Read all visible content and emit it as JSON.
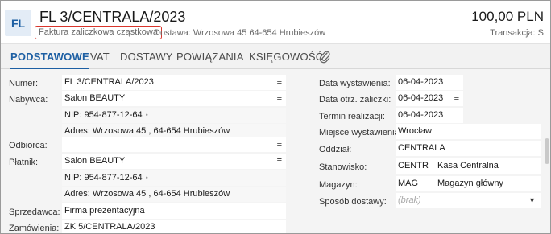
{
  "header": {
    "badge": "FL",
    "title": "FL 3/CENTRALA/2023",
    "doc_type": "Faktura zaliczkowa cząstkowa",
    "separator": "•",
    "delivery": "Dostawa: Wrzosowa  45  64-654 Hrubieszów",
    "amount": "100,00 PLN",
    "transaction": "Transakcja:  S"
  },
  "tabs": [
    "PODSTAWOWE",
    "VAT",
    "DOSTAWY",
    "POWIĄZANIA",
    "KSIĘGOWOŚĆ"
  ],
  "left": {
    "numer_label": "Numer:",
    "numer_value": "FL 3/CENTRALA/2023",
    "nabywca_label": "Nabywca:",
    "nabywca_value": "Salon BEAUTY",
    "nabywca_nip": "NIP:  954-877-12-64",
    "nabywca_adres": "Adres:  Wrzosowa  45 , 64-654 Hrubieszów",
    "odbiorca_label": "Odbiorca:",
    "odbiorca_value": "",
    "platnik_label": "Płatnik:",
    "platnik_value": "Salon BEAUTY",
    "platnik_nip": "NIP:  954-877-12-64",
    "platnik_adres": "Adres:  Wrzosowa  45 , 64-654 Hrubieszów",
    "sprzedawca_label": "Sprzedawca:",
    "sprzedawca_value": "Firma prezentacyjna",
    "zamowienia_label": "Zamówienia:",
    "zamowienia_value": "ZK 5/CENTRALA/2023"
  },
  "right": {
    "data_wyst_label": "Data wystawienia:",
    "data_wyst_value": "06-04-2023",
    "data_otrz_label": "Data otrz. zaliczki:",
    "data_otrz_value": "06-04-2023",
    "termin_label": "Termin realizacji:",
    "termin_value": "06-04-2023",
    "miejsce_label": "Miejsce wystawienia:",
    "miejsce_value": "Wrocław",
    "oddzial_label": "Oddział:",
    "oddzial_value": "CENTRALA",
    "stanowisko_label": "Stanowisko:",
    "stanowisko_code": "CENTR",
    "stanowisko_name": "Kasa Centralna",
    "magazyn_label": "Magazyn:",
    "magazyn_code": "MAG",
    "magazyn_name": "Magazyn główny",
    "sposob_label": "Sposób dostawy:",
    "sposob_placeholder": "(brak)"
  },
  "icons": {
    "menu": "≡",
    "chevron": "▼",
    "dot": "•"
  },
  "colors": {
    "accent": "#1d5fa3",
    "highlight_border": "#d9342b"
  }
}
